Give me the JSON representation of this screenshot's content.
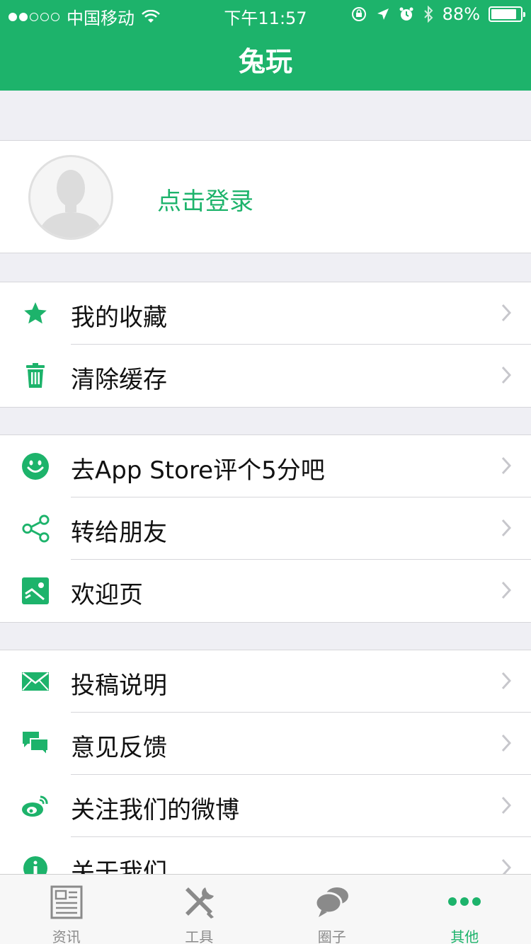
{
  "status": {
    "carrier": "中国移动",
    "time": "下午11:57",
    "battery": "88%",
    "battery_level": 0.88
  },
  "header": {
    "title": "兔玩"
  },
  "profile": {
    "login_label": "点击登录"
  },
  "menu": {
    "favorites": "我的收藏",
    "clear_cache": "清除缓存",
    "rate": "去App Store评个5分吧",
    "share": "转给朋友",
    "welcome": "欢迎页",
    "contribute": "投稿说明",
    "feedback": "意见反馈",
    "weibo": "关注我们的微博",
    "about": "关于我们"
  },
  "tabs": [
    {
      "label": "资讯",
      "icon": "news-icon"
    },
    {
      "label": "工具",
      "icon": "tools-icon"
    },
    {
      "label": "圈子",
      "icon": "chat-bubbles-icon"
    },
    {
      "label": "其他",
      "icon": "more-dots-icon",
      "active": true
    }
  ],
  "colors": {
    "accent": "#1db36b",
    "background": "#efeff4"
  }
}
